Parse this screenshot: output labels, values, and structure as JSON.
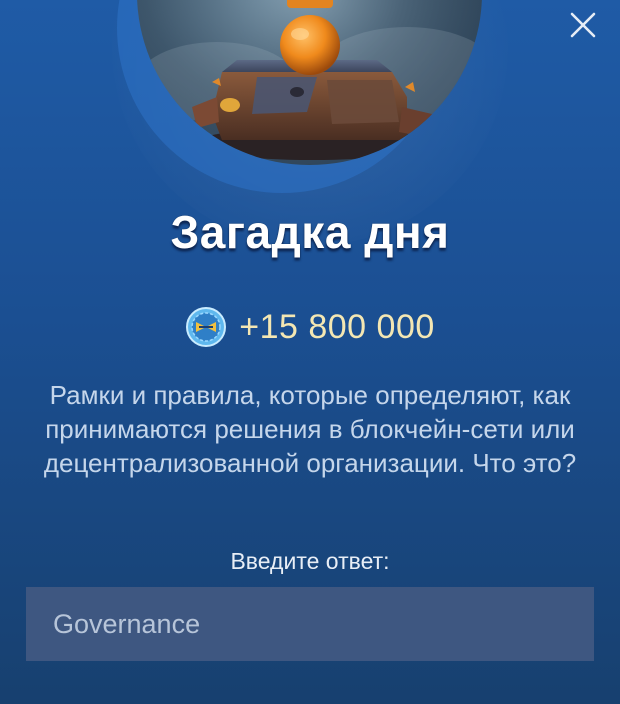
{
  "dialog": {
    "title": "Загадка дня",
    "reward": {
      "amount": "+15 800 000",
      "icon": "coin-icon"
    },
    "question": "Рамки и правила, которые определяют, как принимаются решения в блокчейн-сети или децентрализованной организации. Что это?",
    "answer_label": "Введите ответ:",
    "answer_value": "Governance",
    "close_icon": "close-icon"
  },
  "colors": {
    "background": "#1b4f92",
    "reward_text": "#f4e7b3",
    "question_text": "#c5d6eb",
    "input_background": "#3e5781"
  }
}
